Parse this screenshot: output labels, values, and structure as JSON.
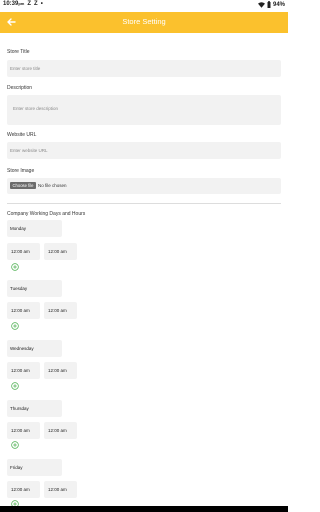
{
  "status_bar": {
    "time": "10:39",
    "ampm": "pm",
    "icons_left": [
      "Z",
      "Z",
      "•"
    ],
    "battery": "94%"
  },
  "app_bar": {
    "title": "Store Setting",
    "back_icon": "arrow-left-icon"
  },
  "store_title": {
    "label": "Store Title",
    "placeholder": "Enter store title"
  },
  "description": {
    "label": "Description",
    "placeholder": "Enter store description"
  },
  "website_url": {
    "label": "Website URL",
    "placeholder": "Enter website URL"
  },
  "store_image": {
    "label": "Store Image",
    "button": "Choose file",
    "status": "No file chosen"
  },
  "working_hours": {
    "heading": "Company Working Days and Hours",
    "days": [
      {
        "day": "Monday",
        "open": "12:00 am",
        "close": "12:00 am"
      },
      {
        "day": "Tuesday",
        "open": "12:00 am",
        "close": "12:00 am"
      },
      {
        "day": "Wednesday",
        "open": "12:00 am",
        "close": "12:00 am"
      },
      {
        "day": "Thursday",
        "open": "12:00 am",
        "close": "12:00 am"
      },
      {
        "day": "Friday",
        "open": "12:00 am",
        "close": "12:00 am"
      }
    ]
  },
  "colors": {
    "accent": "#fbc12d",
    "add_icon": "#4caf50",
    "field_bg": "#f2f2f2"
  }
}
